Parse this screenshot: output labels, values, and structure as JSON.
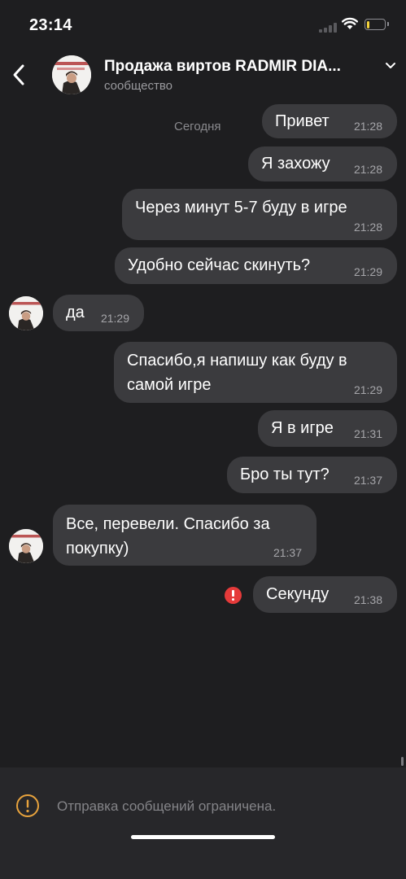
{
  "status_bar": {
    "time": "23:14",
    "battery_level": 0.2
  },
  "header": {
    "title": "Продажа виртов RADMIR DIA...",
    "subtitle": "сообщество"
  },
  "date_separator": "Сегодня",
  "messages": [
    {
      "direction": "outgoing",
      "text": "Привет",
      "time": "21:28"
    },
    {
      "direction": "outgoing",
      "text": "Я захожу",
      "time": "21:28"
    },
    {
      "direction": "outgoing",
      "text": "Через минут 5-7 буду в игре",
      "time": "21:28"
    },
    {
      "direction": "outgoing",
      "text": "Удобно сейчас скинуть?",
      "time": "21:29"
    },
    {
      "direction": "incoming",
      "text": "да",
      "time": "21:29"
    },
    {
      "direction": "outgoing",
      "text": "Спасибо,я напишу как буду в\nсамой игре",
      "time": "21:29"
    },
    {
      "direction": "outgoing",
      "text": "Я в игре",
      "time": "21:31"
    },
    {
      "direction": "outgoing",
      "text": "Бро ты тут?",
      "time": "21:37"
    },
    {
      "direction": "incoming",
      "text": "Все, перевели. Спасибо за\nпокупку)",
      "time": "21:37"
    },
    {
      "direction": "outgoing",
      "text": "Секунду",
      "time": "21:38",
      "status": "failed"
    }
  ],
  "footer": {
    "notice": "Отправка сообщений ограничена."
  },
  "colors": {
    "background": "#1e1e20",
    "bubble": "#3b3b3e",
    "error": "#e53a3a",
    "warning": "#e8a33d"
  },
  "icons": [
    "back-icon",
    "chevron-down-icon",
    "error-icon",
    "warning-icon",
    "wifi-icon",
    "battery-icon",
    "signal-icon"
  ]
}
